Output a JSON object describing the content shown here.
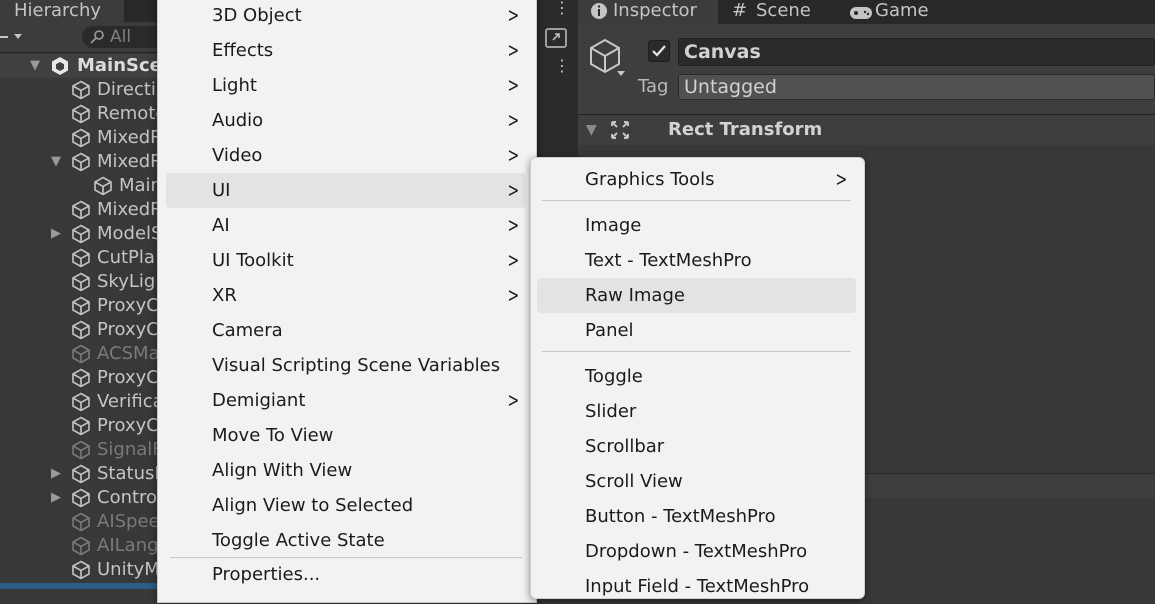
{
  "hierarchy": {
    "tab_label": "Hierarchy",
    "search_placeholder": "All",
    "scene_name": "MainScene",
    "rows": [
      {
        "label": "Directi",
        "dim": false,
        "fold": ""
      },
      {
        "label": "Remote",
        "dim": false,
        "fold": ""
      },
      {
        "label": "MixedR",
        "dim": false,
        "fold": ""
      },
      {
        "label": "MixedR",
        "dim": false,
        "fold": "▼"
      },
      {
        "label": "Main",
        "dim": false,
        "fold": ""
      },
      {
        "label": "MixedR",
        "dim": false,
        "fold": ""
      },
      {
        "label": "ModelS",
        "dim": false,
        "fold": "▶"
      },
      {
        "label": "CutPla",
        "dim": false,
        "fold": ""
      },
      {
        "label": "SkyLig",
        "dim": false,
        "fold": ""
      },
      {
        "label": "ProxyC",
        "dim": false,
        "fold": ""
      },
      {
        "label": "ProxyC",
        "dim": false,
        "fold": ""
      },
      {
        "label": "ACSMa",
        "dim": true,
        "fold": ""
      },
      {
        "label": "ProxyC",
        "dim": false,
        "fold": ""
      },
      {
        "label": "Verifica",
        "dim": false,
        "fold": ""
      },
      {
        "label": "ProxyC",
        "dim": false,
        "fold": ""
      },
      {
        "label": "SignalF",
        "dim": true,
        "fold": ""
      },
      {
        "label": "StatusB",
        "dim": false,
        "fold": "▶"
      },
      {
        "label": "Contro",
        "dim": false,
        "fold": "▶"
      },
      {
        "label": "AISpee",
        "dim": true,
        "fold": ""
      },
      {
        "label": "AILang",
        "dim": true,
        "fold": ""
      },
      {
        "label": "UnityM",
        "dim": false,
        "fold": ""
      }
    ]
  },
  "tabs": {
    "inspector": "Inspector",
    "scene": "Scene",
    "game": "Game"
  },
  "inspector": {
    "object_name": "Canvas",
    "tag_label": "Tag",
    "tag_value": "Untagged",
    "component_title": "Rect Transform"
  },
  "context_menu": {
    "items": [
      {
        "label": "3D Object",
        "submenu": true
      },
      {
        "label": "Effects",
        "submenu": true
      },
      {
        "label": "Light",
        "submenu": true
      },
      {
        "label": "Audio",
        "submenu": true
      },
      {
        "label": "Video",
        "submenu": true
      },
      {
        "label": "UI",
        "submenu": true
      },
      {
        "label": "AI",
        "submenu": true
      },
      {
        "label": "UI Toolkit",
        "submenu": true
      },
      {
        "label": "XR",
        "submenu": true
      },
      {
        "label": "Camera",
        "submenu": false
      },
      {
        "label": "Visual Scripting Scene Variables",
        "submenu": false
      },
      {
        "label": "Demigiant",
        "submenu": true
      },
      {
        "label": "Move To View",
        "submenu": false
      },
      {
        "label": "Align With View",
        "submenu": false
      },
      {
        "label": "Align View to Selected",
        "submenu": false
      },
      {
        "label": "Toggle Active State",
        "submenu": false
      }
    ],
    "footer_item": "Properties..."
  },
  "ui_submenu": {
    "group1": [
      "Graphics Tools"
    ],
    "group2": [
      "Image",
      "Text - TextMeshPro",
      "Raw Image",
      "Panel"
    ],
    "group3": [
      "Toggle",
      "Slider",
      "Scrollbar",
      "Scroll View",
      "Button - TextMeshPro",
      "Dropdown - TextMeshPro",
      "Input Field - TextMeshPro"
    ]
  },
  "colors": {
    "editor_bg": "#383838",
    "menu_bg": "#f2f2f2",
    "menu_highlight": "#e3e3e3",
    "selection_blue": "#2c5d87"
  }
}
